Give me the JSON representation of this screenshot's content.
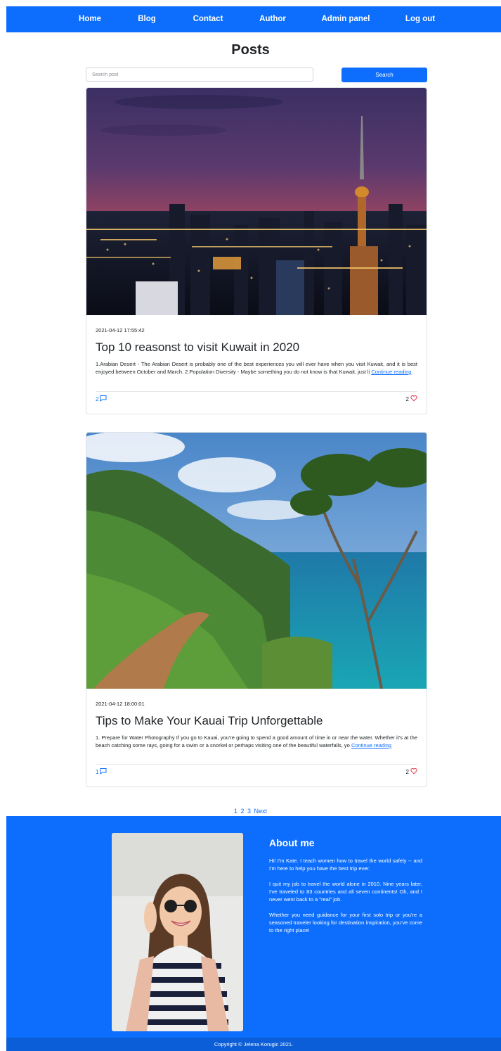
{
  "nav": {
    "home": "Home",
    "blog": "Blog",
    "contact": "Contact",
    "author": "Author",
    "admin": "Admin panel",
    "logout": "Log out"
  },
  "page_title": "Posts",
  "search": {
    "placeholder": "Search post",
    "button": "Search"
  },
  "posts": [
    {
      "date": "2021-04-12 17:55:42",
      "title": "Top 10 reasonst to visit Kuwait in 2020",
      "excerpt": "1.Arabian Desert - The Arabian Desert is probably one of the best experiences you will ever have when you visit Kuwait, and it is best enjoyed between October and March. 2.Population Diversity - Maybe something you do not know is that Kuwait, just li",
      "link": "Continue reading",
      "comments": "2",
      "likes": "2"
    },
    {
      "date": "2021-04-12 18:00:01",
      "title": "Tips to Make Your Kauai Trip Unforgettable",
      "excerpt": "1. Prepare for Water Photography If you go to Kauai, you're going to spend a good amount of time in or near the water. Whether it's at the beach catching some rays, going for a swim or a snorkel or perhaps visiting one of the beautiful waterfalls, yo",
      "link": "Continue reading",
      "comments": "1",
      "likes": "2"
    }
  ],
  "pagination": {
    "pages": [
      "1",
      "2",
      "3"
    ],
    "next": "Next"
  },
  "about": {
    "title": "About me",
    "p1": "Hi! I'm Kate. I teach women how to travel the world safely -- and I'm here to help you have the best trip ever.",
    "p2": "I quit my job to travel the world alone in 2010. Nine years later, I've traveled to 83 countries and all seven continents! Oh, and I never went back to a \"real\" job.",
    "p3": "Whether you need guidance for your first solo trip or you're a seasoned traveler looking for destination inspiration, you've come to the right place!"
  },
  "copyright": "Copyright © Jelena Korugic 2021.",
  "colors": {
    "primary": "#0d6efd",
    "heart": "#dc3545"
  },
  "icons": {
    "comments": "chat-bubble-icon",
    "likes": "heart-icon"
  }
}
